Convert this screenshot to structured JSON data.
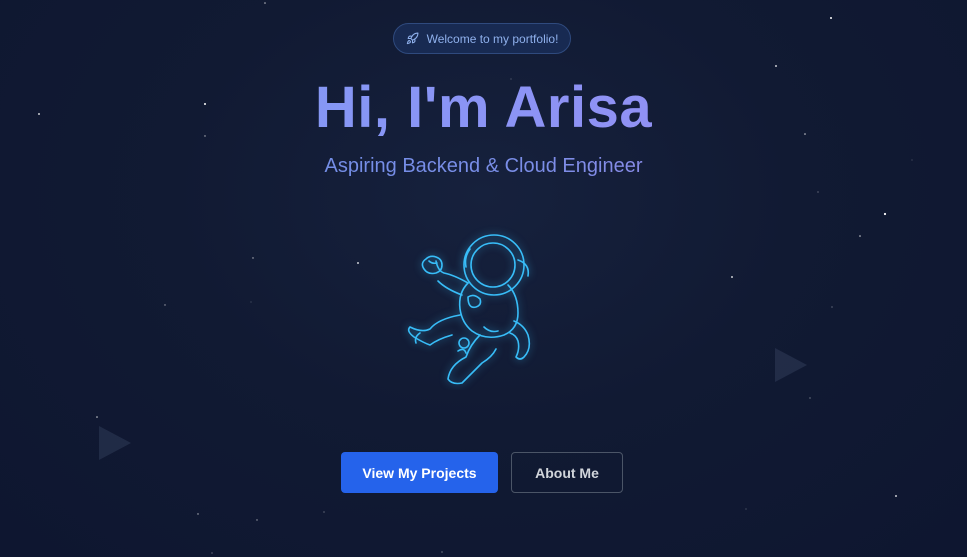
{
  "hero": {
    "badge_text": "Welcome to my portfolio!",
    "badge_icon": "rocket-icon",
    "title": "Hi, I'm Arisa",
    "subtitle": "Aspiring Backend & Cloud Engineer",
    "illustration": "astronaut-icon"
  },
  "actions": {
    "primary_label": "View My Projects",
    "secondary_label": "About Me"
  },
  "colors": {
    "background": "#111a33",
    "accent": "#2563eb",
    "title_gradient_start": "#7c9df4",
    "title_gradient_end": "#9b8cf3",
    "astronaut_stroke": "#38bdf8"
  }
}
